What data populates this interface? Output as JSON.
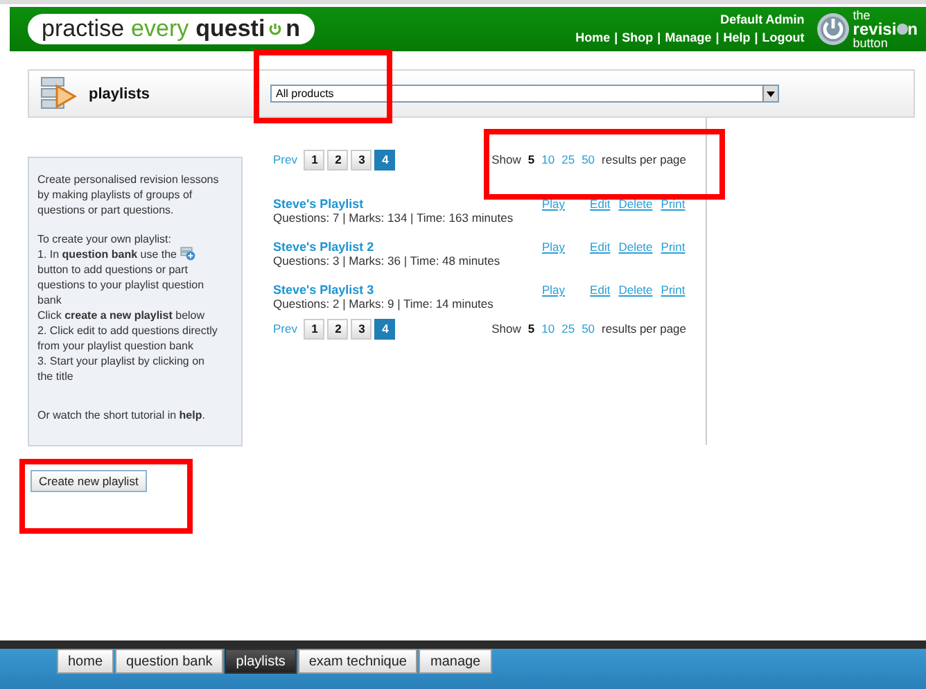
{
  "header": {
    "logo": {
      "word_1": "practise",
      "word_2": "every",
      "word_3_start": "questi",
      "word_3_end": "n"
    },
    "user": "Default Admin",
    "links": [
      {
        "label": "Home"
      },
      {
        "label": "Shop"
      },
      {
        "label": "Manage"
      },
      {
        "label": "Help"
      },
      {
        "label": "Logout"
      }
    ],
    "separator": "|",
    "brand": {
      "top": "the",
      "middle_start": "revisi",
      "middle_end": "n",
      "bottom": "button"
    }
  },
  "title_bar": {
    "title": "playlists",
    "product_dropdown": {
      "value": "All products"
    }
  },
  "help_panel": {
    "paragraphs": [
      {
        "text": "Create personalised revision lessons by making playlists of groups of questions or part questions."
      },
      {
        "text": "To create your own playlist:"
      },
      {
        "text": "1.  In **question bank** use the",
        "text_after": "button to add questions or part questions to your playlist question bank"
      },
      {
        "text": "Click **create a new playlist** below"
      },
      {
        "text": "2.  Click edit to add questions directly from your playlist question bank"
      },
      {
        "text": "3.  Start your playlist by clicking on the title"
      },
      {
        "text": "Or watch the short tutorial in **help**."
      }
    ]
  },
  "create_button": "Create new playlist",
  "pagers": [
    {
      "prev": "Prev",
      "pages": [
        {
          "label": "1",
          "selected": false
        },
        {
          "label": "2",
          "selected": false
        },
        {
          "label": "3",
          "selected": false
        },
        {
          "label": "4",
          "selected": true
        }
      ],
      "show": "Show",
      "sizes": [
        {
          "label": "5",
          "selected": true
        },
        {
          "label": "10",
          "selected": false
        },
        {
          "label": "25",
          "selected": false
        },
        {
          "label": "50",
          "selected": false
        }
      ],
      "suffix": "results per page"
    },
    {
      "prev": "Prev",
      "pages": [
        {
          "label": "1",
          "selected": false
        },
        {
          "label": "2",
          "selected": false
        },
        {
          "label": "3",
          "selected": false
        },
        {
          "label": "4",
          "selected": true
        }
      ],
      "show": "Show",
      "sizes": [
        {
          "label": "5",
          "selected": true
        },
        {
          "label": "10",
          "selected": false
        },
        {
          "label": "25",
          "selected": false
        },
        {
          "label": "50",
          "selected": false
        }
      ],
      "suffix": "results per page"
    }
  ],
  "playlists": [
    {
      "title": "Steve's Playlist",
      "meta": "Questions: 7 | Marks: 134 | Time: 163 minutes",
      "actions": [
        "Play",
        "Edit",
        "Delete",
        "Print"
      ]
    },
    {
      "title": "Steve's Playlist 2",
      "meta": "Questions: 3 | Marks: 36 | Time: 48 minutes",
      "actions": [
        "Play",
        "Edit",
        "Delete",
        "Print"
      ]
    },
    {
      "title": "Steve's Playlist 3",
      "meta": "Questions: 2 | Marks: 9 | Time: 14 minutes",
      "actions": [
        "Play",
        "Edit",
        "Delete",
        "Print"
      ]
    }
  ],
  "bottom_nav": [
    {
      "label": "home",
      "selected": false
    },
    {
      "label": "question bank",
      "selected": false
    },
    {
      "label": "playlists",
      "selected": true
    },
    {
      "label": "exam technique",
      "selected": false
    },
    {
      "label": "manage",
      "selected": false
    }
  ]
}
